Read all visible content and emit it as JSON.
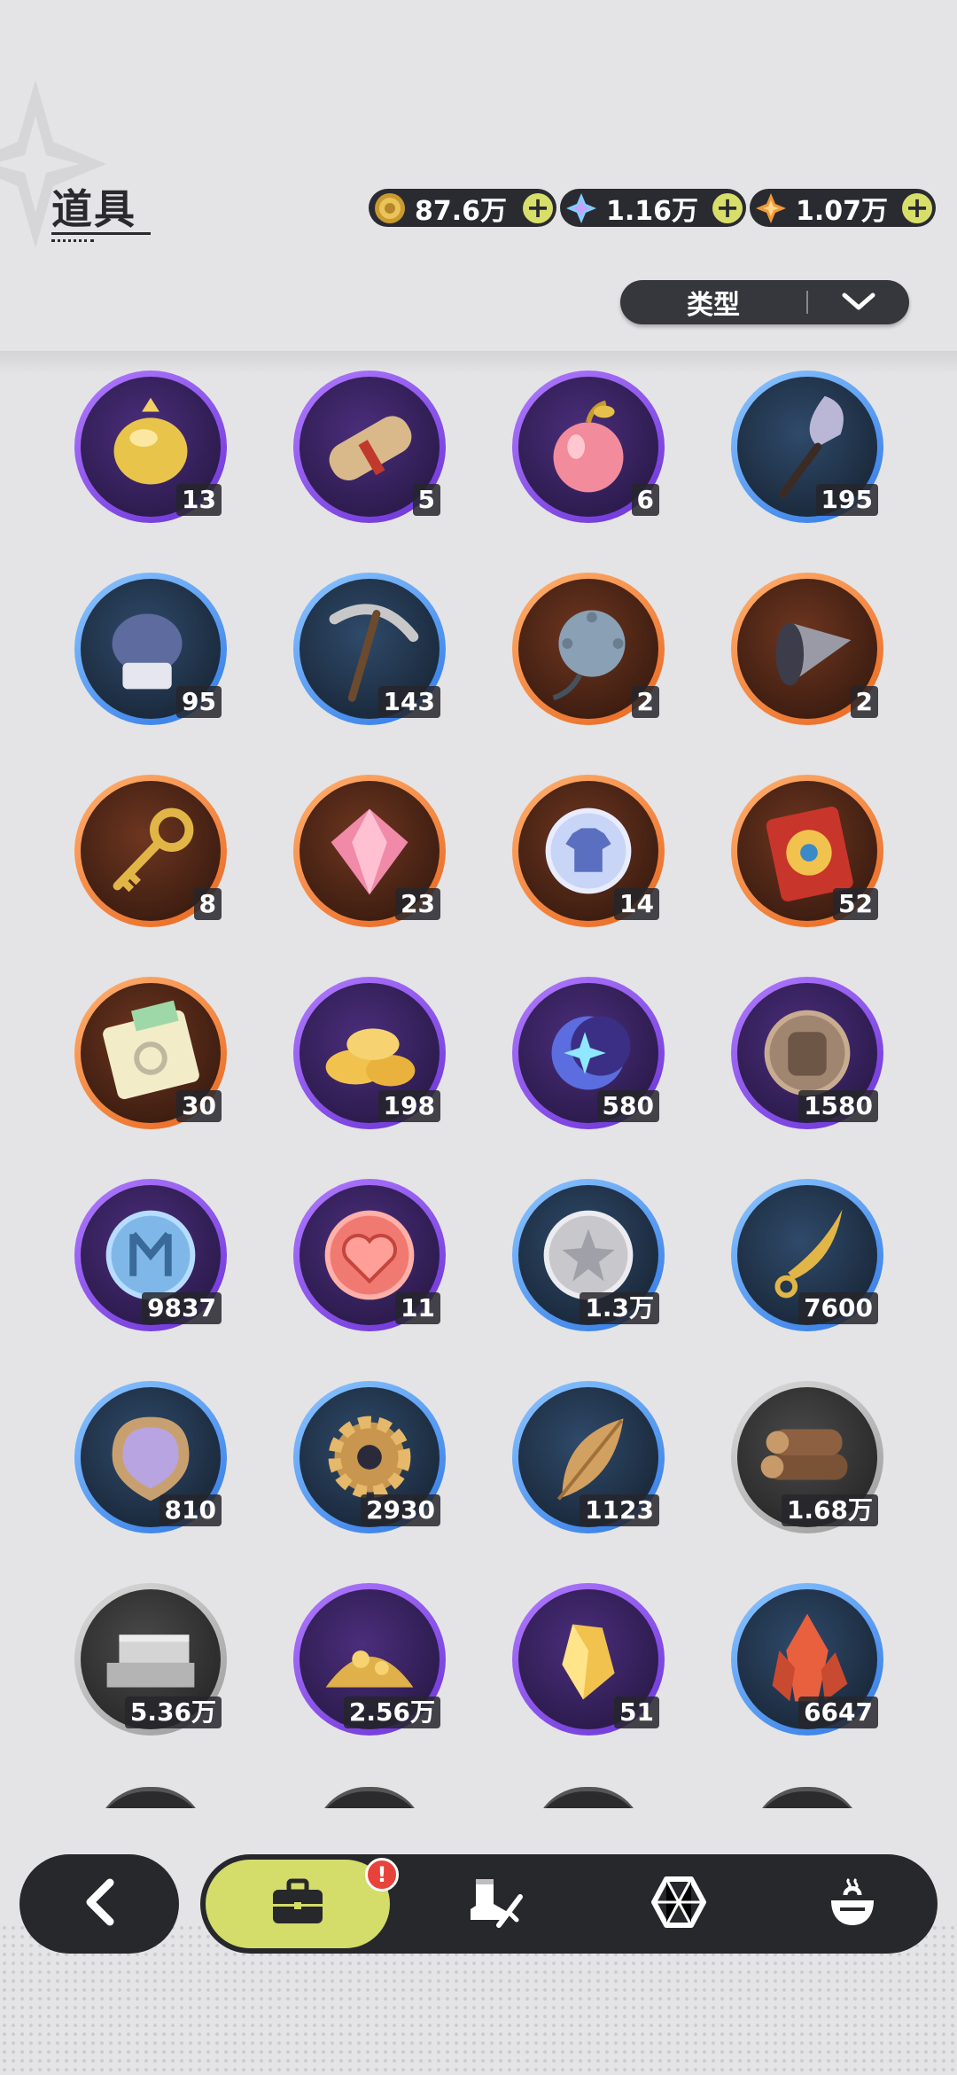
{
  "header": {
    "title": "道具"
  },
  "currencies": [
    {
      "icon": "gold-coin-icon",
      "value": "87.6万"
    },
    {
      "icon": "crystal-gem-icon",
      "value": "1.16万"
    },
    {
      "icon": "amber-star-gem-icon",
      "value": "1.07万"
    }
  ],
  "filter": {
    "label": "类型"
  },
  "items": [
    {
      "name": "golden-helmet-icon",
      "rarity": "purple",
      "count": "13"
    },
    {
      "name": "scroll-icon",
      "rarity": "purple",
      "count": "5"
    },
    {
      "name": "apple-icon",
      "rarity": "purple",
      "count": "6"
    },
    {
      "name": "shovel-icon",
      "rarity": "blue",
      "count": "195"
    },
    {
      "name": "boxing-glove-icon",
      "rarity": "blue",
      "count": "95"
    },
    {
      "name": "pickaxe-icon",
      "rarity": "blue",
      "count": "143"
    },
    {
      "name": "spiked-ball-icon",
      "rarity": "orange",
      "count": "2"
    },
    {
      "name": "drill-icon",
      "rarity": "orange",
      "count": "2"
    },
    {
      "name": "golden-key-icon",
      "rarity": "orange",
      "count": "8"
    },
    {
      "name": "pink-gem-icon",
      "rarity": "orange",
      "count": "23"
    },
    {
      "name": "shirt-token-icon",
      "rarity": "orange",
      "count": "14"
    },
    {
      "name": "wheel-ticket-icon",
      "rarity": "orange",
      "count": "52"
    },
    {
      "name": "rainbow-ticket-icon",
      "rarity": "orange",
      "count": "30"
    },
    {
      "name": "gold-ingot-icon",
      "rarity": "purple",
      "count": "198"
    },
    {
      "name": "moon-star-icon",
      "rarity": "purple",
      "count": "580"
    },
    {
      "name": "fist-coin-icon",
      "rarity": "purple",
      "count": "1580"
    },
    {
      "name": "blue-medal-icon",
      "rarity": "purple",
      "count": "9837"
    },
    {
      "name": "heart-coin-icon",
      "rarity": "purple",
      "count": "11"
    },
    {
      "name": "silver-star-coin-icon",
      "rarity": "blue",
      "count": "1.3万"
    },
    {
      "name": "blade-icon",
      "rarity": "blue",
      "count": "7600"
    },
    {
      "name": "scale-badge-icon",
      "rarity": "blue",
      "count": "810"
    },
    {
      "name": "gear-icon",
      "rarity": "blue",
      "count": "2930"
    },
    {
      "name": "leaf-icon",
      "rarity": "blue",
      "count": "1123"
    },
    {
      "name": "wood-logs-icon",
      "rarity": "gray",
      "count": "1.68万"
    },
    {
      "name": "stone-bricks-icon",
      "rarity": "gray",
      "count": "5.36万"
    },
    {
      "name": "gold-ore-icon",
      "rarity": "purple",
      "count": "2.56万"
    },
    {
      "name": "gold-crystal-icon",
      "rarity": "purple",
      "count": "51"
    },
    {
      "name": "red-crystal-icon",
      "rarity": "blue",
      "count": "6647"
    }
  ],
  "nav": {
    "badge": "!",
    "tabs": [
      "briefcase-icon",
      "boot-sword-icon",
      "hexagon-icon",
      "pot-icon"
    ]
  },
  "colors": {
    "accent": "#d4dc6a",
    "dark": "#27282c",
    "background": "#e4e4e6"
  }
}
